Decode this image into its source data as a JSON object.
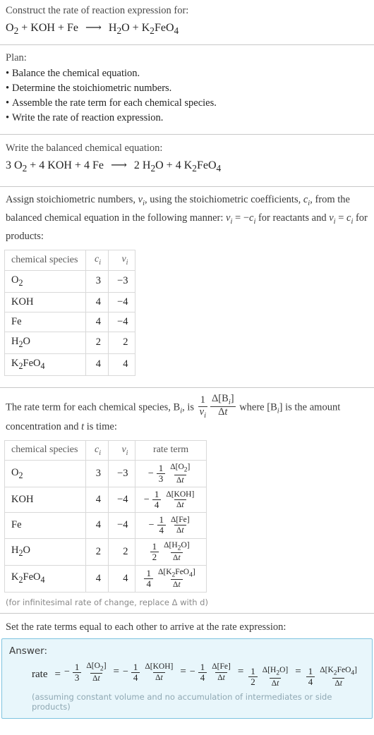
{
  "prompt": {
    "instruction": "Construct the rate of reaction expression for:",
    "equation_plain": "O_2 + KOH + Fe ⟶ H_2O + K_2FeO_4"
  },
  "plan": {
    "heading": "Plan:",
    "items": [
      "Balance the chemical equation.",
      "Determine the stoichiometric numbers.",
      "Assemble the rate term for each chemical species.",
      "Write the rate of reaction expression."
    ]
  },
  "balanced": {
    "heading": "Write the balanced chemical equation:",
    "equation_plain": "3 O_2 + 4 KOH + 4 Fe ⟶ 2 H_2O + 4 K_2FeO_4",
    "reactants": [
      {
        "coefficient": "3",
        "formula": "O2"
      },
      {
        "coefficient": "4",
        "formula": "KOH"
      },
      {
        "coefficient": "4",
        "formula": "Fe"
      }
    ],
    "products": [
      {
        "coefficient": "2",
        "formula": "H2O"
      },
      {
        "coefficient": "4",
        "formula": "K2FeO4"
      }
    ],
    "arrow": "⟶"
  },
  "stoich_text": {
    "part1": "Assign stoichiometric numbers, ",
    "nu": "ν",
    "part2": ", using the stoichiometric coefficients, ",
    "c": "c",
    "part3": ", from the balanced chemical equation in the following manner: ",
    "rule_reactants": " = −",
    "part4": " for reactants and ",
    "rule_products": " = ",
    "part5": " for products:"
  },
  "table1": {
    "headers": [
      "chemical species",
      "c",
      "ν"
    ],
    "header_sub": "i",
    "rows": [
      {
        "species": "O2",
        "c": "3",
        "nu": "−3"
      },
      {
        "species": "KOH",
        "c": "4",
        "nu": "−4"
      },
      {
        "species": "Fe",
        "c": "4",
        "nu": "−4"
      },
      {
        "species": "H2O",
        "c": "2",
        "nu": "2"
      },
      {
        "species": "K2FeO4",
        "c": "4",
        "nu": "4"
      }
    ]
  },
  "rate_text": {
    "part1": "The rate term for each chemical species, B",
    "part2": ", is ",
    "frac_num": "1",
    "frac_den": "ν",
    "delta_num": "Δ[B",
    "delta_den": "Δt",
    "part3": " where [B",
    "part4": "] is the amount concentration and ",
    "t": "t",
    "part5": " is time:"
  },
  "table2": {
    "headers": [
      "chemical species",
      "c",
      "ν",
      "rate term"
    ],
    "header_sub": "i",
    "rows": [
      {
        "species": "O2",
        "c": "3",
        "nu": "−3",
        "sign": "−",
        "coef_num": "1",
        "coef_den": "3",
        "delta_num": "Δ[O2]",
        "delta_den": "Δt"
      },
      {
        "species": "KOH",
        "c": "4",
        "nu": "−4",
        "sign": "−",
        "coef_num": "1",
        "coef_den": "4",
        "delta_num": "Δ[KOH]",
        "delta_den": "Δt"
      },
      {
        "species": "Fe",
        "c": "4",
        "nu": "−4",
        "sign": "−",
        "coef_num": "1",
        "coef_den": "4",
        "delta_num": "Δ[Fe]",
        "delta_den": "Δt"
      },
      {
        "species": "H2O",
        "c": "2",
        "nu": "2",
        "sign": "",
        "coef_num": "1",
        "coef_den": "2",
        "delta_num": "Δ[H2O]",
        "delta_den": "Δt"
      },
      {
        "species": "K2FeO4",
        "c": "4",
        "nu": "4",
        "sign": "",
        "coef_num": "1",
        "coef_den": "4",
        "delta_num": "Δ[K2FeO4]",
        "delta_den": "Δt"
      }
    ]
  },
  "footnote": "(for infinitesimal rate of change, replace Δ with d)",
  "set_equal_text": "Set the rate terms equal to each other to arrive at the rate expression:",
  "answer": {
    "label": "Answer:",
    "rate_word": "rate",
    "equals": "=",
    "terms": [
      {
        "sign": "−",
        "coef_num": "1",
        "coef_den": "3",
        "delta_num": "Δ[O2]",
        "delta_den": "Δt"
      },
      {
        "sign": "−",
        "coef_num": "1",
        "coef_den": "4",
        "delta_num": "Δ[KOH]",
        "delta_den": "Δt"
      },
      {
        "sign": "−",
        "coef_num": "1",
        "coef_den": "4",
        "delta_num": "Δ[Fe]",
        "delta_den": "Δt"
      },
      {
        "sign": "",
        "coef_num": "1",
        "coef_den": "2",
        "delta_num": "Δ[H2O]",
        "delta_den": "Δt"
      },
      {
        "sign": "",
        "coef_num": "1",
        "coef_den": "4",
        "delta_num": "Δ[K2FeO4]",
        "delta_den": "Δt"
      }
    ],
    "note": "(assuming constant volume and no accumulation of intermediates or side products)",
    "expression_plain": "rate = -1/3 Δ[O2]/Δt = -1/4 Δ[KOH]/Δt = -1/4 Δ[Fe]/Δt = 1/2 Δ[H2O]/Δt = 1/4 Δ[K2FeO4]/Δt"
  },
  "colors": {
    "answer_bg": "#e8f6fb",
    "answer_border": "#7ec3e0",
    "rule": "#c8c8c8",
    "text": "#232323",
    "muted": "#4a4a4a"
  }
}
